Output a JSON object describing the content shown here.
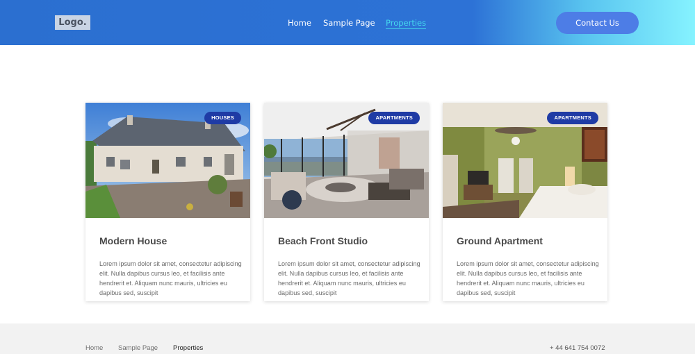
{
  "header": {
    "logo": "Logo.",
    "nav": [
      {
        "label": "Home",
        "active": false
      },
      {
        "label": "Sample Page",
        "active": false
      },
      {
        "label": "Properties",
        "active": true
      }
    ],
    "contact_label": "Contact Us"
  },
  "cards": [
    {
      "badge": "HOUSES",
      "title": "Modern House",
      "text": "Lorem ipsum dolor sit amet, consectetur adipiscing elit. Nulla dapibus cursus leo, et facilisis ante hendrerit et. Aliquam nunc mauris, ultricies eu dapibus sed, suscipit"
    },
    {
      "badge": "APARTMENTS",
      "title": "Beach Front Studio",
      "text": "Lorem ipsum dolor sit amet, consectetur adipiscing elit. Nulla dapibus cursus leo, et facilisis ante hendrerit et. Aliquam nunc mauris, ultricies eu dapibus sed, suscipit"
    },
    {
      "badge": "APARTMENTS",
      "title": "Ground Apartment",
      "text": "Lorem ipsum dolor sit amet, consectetur adipiscing elit. Nulla dapibus cursus leo, et facilisis ante hendrerit et. Aliquam nunc mauris, ultricies eu dapibus sed, suscipit"
    }
  ],
  "footer": {
    "links": [
      "Home",
      "Sample Page",
      "Properties"
    ],
    "phone": "+ 44 641 754 0072"
  },
  "colors": {
    "header_start": "#2b6fd0",
    "header_end": "#86f3ff",
    "contact_button": "#4d7de6",
    "nav_active": "#44d8ee",
    "badge": "#1f3ba5",
    "footer_bg": "#f2f2f2"
  }
}
